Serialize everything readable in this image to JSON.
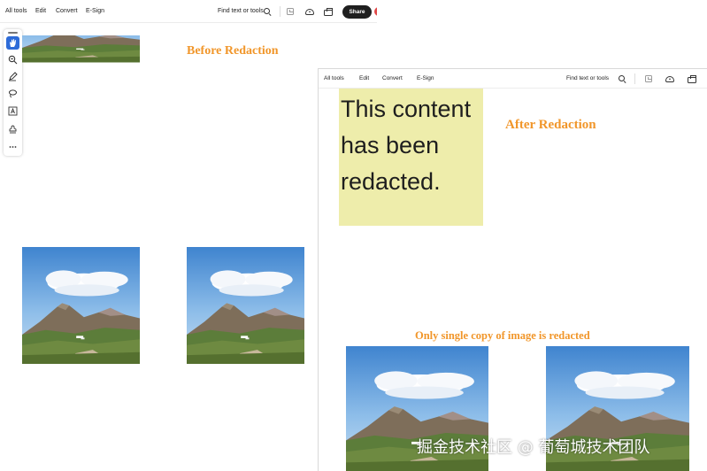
{
  "toolbar": {
    "all_tools": "All tools",
    "edit": "Edit",
    "convert": "Convert",
    "esign": "E-Sign",
    "find_placeholder": "Find text or tools",
    "share": "Share"
  },
  "left_tools": [
    {
      "name": "hand-icon",
      "active": true
    },
    {
      "name": "zoom-icon"
    },
    {
      "name": "pen-icon"
    },
    {
      "name": "lasso-icon"
    },
    {
      "name": "text-box-icon"
    },
    {
      "name": "stamp-icon"
    },
    {
      "name": "more-icon"
    }
  ],
  "before_doc": {
    "heading": "Before Redaction"
  },
  "after_doc": {
    "heading": "After Redaction",
    "redaction_lines": [
      "This content",
      "has been",
      "redacted."
    ],
    "note": "Only single copy of image is redacted"
  },
  "watermark": "掘金技术社区 @ 葡萄城技术团队",
  "colors": {
    "heading": "#f1962a",
    "redaction": "#eeedab",
    "share_button": "#1f1f1f",
    "active_tool": "#2d6bd8"
  }
}
